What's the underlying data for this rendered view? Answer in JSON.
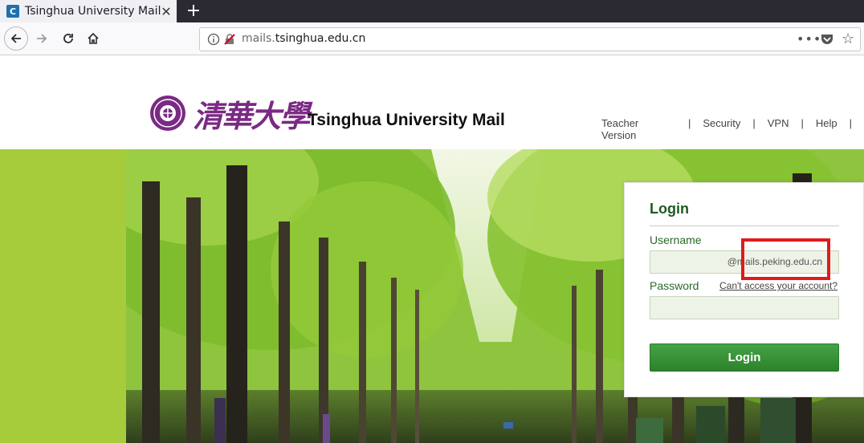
{
  "browser": {
    "tab_title": "Tsinghua University Mail",
    "favicon_letter": "C",
    "close_glyph": "✕",
    "new_tab_glyph": "+",
    "url_scheme_part": "mails.",
    "url_host_part": "tsinghua.edu.cn",
    "more_glyph": "•••",
    "star_glyph": "☆"
  },
  "header": {
    "logo_chars": "清華大學",
    "site_title": "Tsinghua University Mail",
    "links": [
      "Teacher Version",
      "Security",
      "VPN",
      "Help"
    ],
    "separator": "|"
  },
  "login": {
    "title": "Login",
    "username_label": "Username",
    "username_domain_suffix": "@mails.peking.edu.cn",
    "password_label": "Password",
    "cant_access": "Can't access your account?",
    "button_label": "Login"
  },
  "colors": {
    "accent_green": "#2b822b",
    "strip_green": "#a6cc3c",
    "logo_purple": "#7a2a84",
    "highlight_red": "#e01b1b"
  }
}
